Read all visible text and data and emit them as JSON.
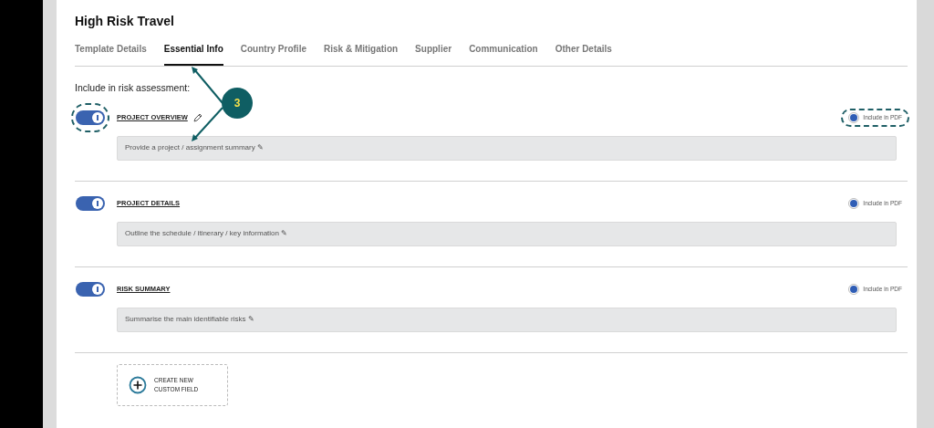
{
  "title": "High Risk Travel",
  "tabs": [
    {
      "label": "Template Details",
      "selected": false
    },
    {
      "label": "Essential Info",
      "selected": true
    },
    {
      "label": "Country Profile",
      "selected": false
    },
    {
      "label": "Risk & Mitigation",
      "selected": false
    },
    {
      "label": "Supplier",
      "selected": false
    },
    {
      "label": "Communication",
      "selected": false
    },
    {
      "label": "Other Details",
      "selected": false
    }
  ],
  "section_heading": "Include in risk assessment:",
  "sections": [
    {
      "label": "PROJECT OVERVIEW",
      "on": true,
      "editable": true,
      "highlighted": true,
      "placeholder": "Provide a project / assignment summary ✎",
      "pdf": {
        "label": "Include in PDF",
        "selected": true
      }
    },
    {
      "label": "PROJECT DETAILS",
      "on": true,
      "editable": false,
      "highlighted": false,
      "placeholder": "Outline the schedule / itinerary / key information ✎",
      "pdf": {
        "label": "Include in PDF",
        "selected": true
      }
    },
    {
      "label": "RISK SUMMARY",
      "on": true,
      "editable": false,
      "highlighted": false,
      "placeholder": "Summarise the main identifiable risks ✎",
      "pdf": {
        "label": "Include in PDF",
        "selected": true
      }
    }
  ],
  "create_button": {
    "label": "CREATE NEW CUSTOM FIELD"
  },
  "callout": {
    "number": "3"
  }
}
